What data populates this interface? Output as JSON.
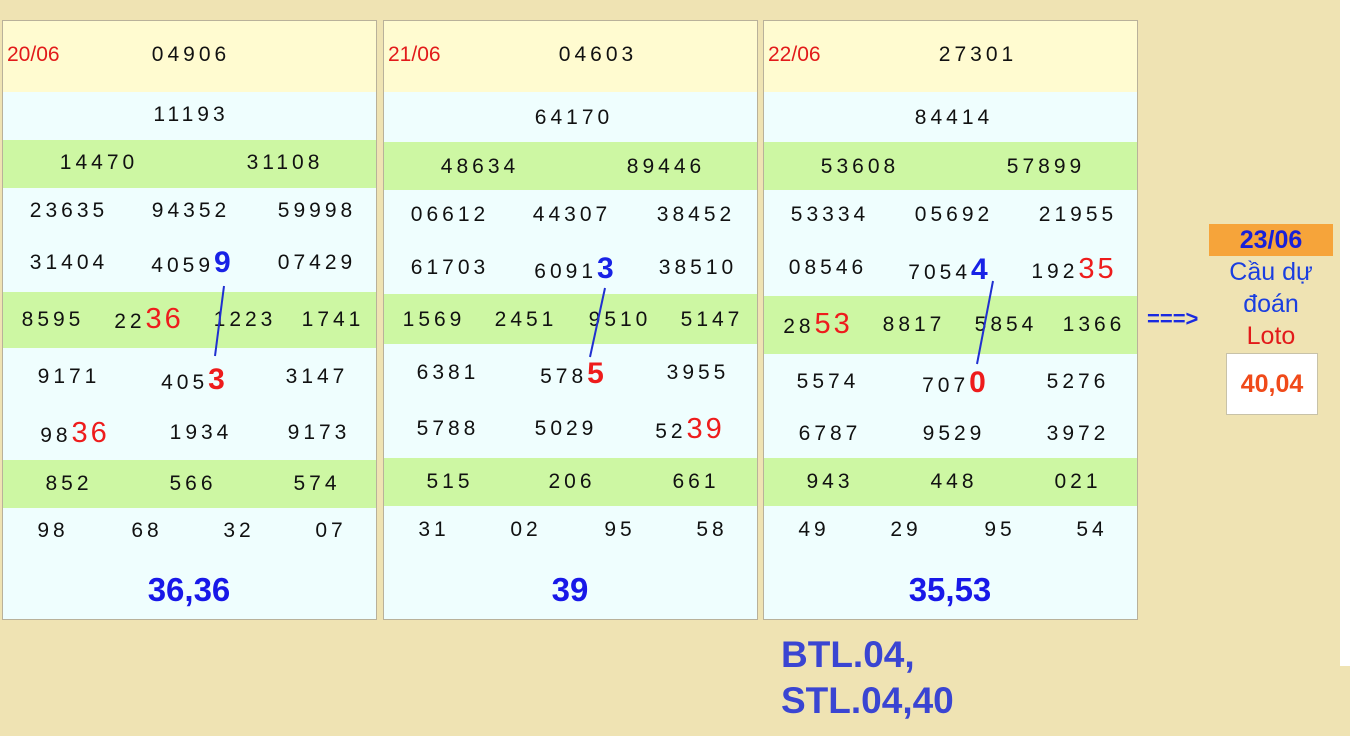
{
  "columns": [
    {
      "date": "20/06",
      "special": "04906",
      "first": "11193",
      "second": [
        "14470",
        "31108"
      ],
      "third_a": [
        "23635",
        "94352",
        "59998"
      ],
      "third_b": [
        "31404",
        "4059",
        "9",
        "07429"
      ],
      "fourth": [
        "8595",
        "22",
        "36",
        "1223",
        "1741"
      ],
      "fifth_a": [
        "9171",
        "405",
        "3",
        "3147"
      ],
      "fifth_b": [
        "98",
        "36",
        "1934",
        "9173"
      ],
      "sixth": [
        "852",
        "566",
        "574"
      ],
      "seventh": [
        "98",
        "68",
        "32",
        "07"
      ],
      "total": "36,36"
    },
    {
      "date": "21/06",
      "special": "04603",
      "first": "64170",
      "second": [
        "48634",
        "89446"
      ],
      "third_a": [
        "06612",
        "44307",
        "38452"
      ],
      "third_b": [
        "61703",
        "6091",
        "3",
        "38510"
      ],
      "fourth": [
        "1569",
        "2451",
        "9510",
        "5147"
      ],
      "fifth_a": [
        "6381",
        "578",
        "5",
        "3955"
      ],
      "fifth_b": [
        "5788",
        "5029",
        "52",
        "39"
      ],
      "sixth": [
        "515",
        "206",
        "661"
      ],
      "seventh": [
        "31",
        "02",
        "95",
        "58"
      ],
      "total": "39"
    },
    {
      "date": "22/06",
      "special": "27301",
      "first": "84414",
      "second": [
        "53608",
        "57899"
      ],
      "third_a": [
        "53334",
        "05692",
        "21955"
      ],
      "third_b": [
        "08546",
        "7054",
        "4",
        "192",
        "35"
      ],
      "fourth": [
        "28",
        "53",
        "8817",
        "5854",
        "1366"
      ],
      "fifth_a": [
        "5574",
        "707",
        "0",
        "5276"
      ],
      "fifth_b": [
        "6787",
        "9529",
        "3972"
      ],
      "sixth": [
        "943",
        "448",
        "021"
      ],
      "seventh": [
        "49",
        "29",
        "95",
        "54"
      ],
      "total": "35,53"
    }
  ],
  "prediction": {
    "arrow": "===>",
    "date": "23/06",
    "line1": "Cầu dự",
    "line2": "đoán",
    "line3": "Loto",
    "value": "40,04"
  },
  "summary": {
    "btl": "BTL.04,",
    "stl": "STL.04,40"
  },
  "colors": {
    "page_bg": "#efe3b3",
    "header_bg": "#fffbd0",
    "green_row": "#cdf7a3",
    "column_bg": "#effefe",
    "date_red": "#e21a1a",
    "total_blue": "#1818e8",
    "pair_red": "#ee1c1c",
    "highlight_blue": "#1822e6",
    "prediction_orange": "#f6a43a",
    "summary_blue": "#3a45d2"
  }
}
